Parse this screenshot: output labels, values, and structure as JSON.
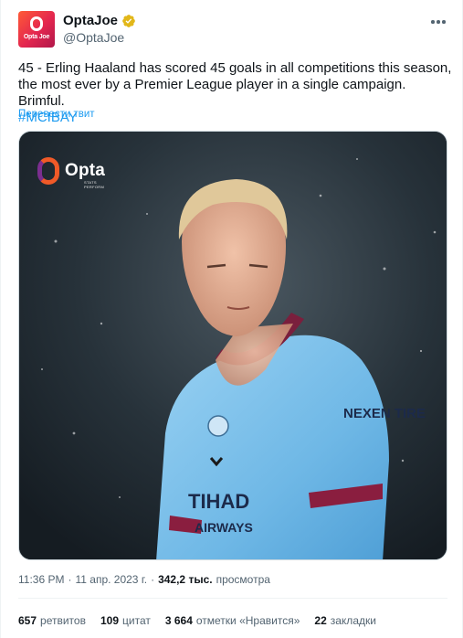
{
  "author": {
    "avatar_text": "Opta Joe",
    "display_name": "OptaJoe",
    "handle": "@OptaJoe",
    "verified_color": "#e2b719"
  },
  "tweet": {
    "text": "45 - Erling Haaland has scored 45 goals in all competitions this season, the most ever by a Premier League player in a single campaign. Brimful.",
    "hashtag": "#MCIBAY",
    "translate_label": "Перевести твит"
  },
  "media": {
    "logo_word": "Opta",
    "logo_sub": "STATS PERFORM",
    "sponsor_text": "NEXEN TIRE",
    "chest_text_line1": "TIHAD",
    "chest_text_line2": "AIRWAYS",
    "kit_color": "#7fc3ec"
  },
  "meta": {
    "time": "11:36 PM",
    "date": "11 апр. 2023 г.",
    "views_count": "342,2 тыс.",
    "views_label": "просмотра"
  },
  "stats": {
    "retweets_count": "657",
    "retweets_label": "ретвитов",
    "quotes_count": "109",
    "quotes_label": "цитат",
    "likes_count": "3 664",
    "likes_label": "отметки «Нравится»",
    "bookmarks_count": "22",
    "bookmarks_label": "закладки"
  },
  "colors": {
    "accent": "#1d9bf0",
    "secondary_text": "#536471",
    "primary_text": "#0f1419"
  }
}
